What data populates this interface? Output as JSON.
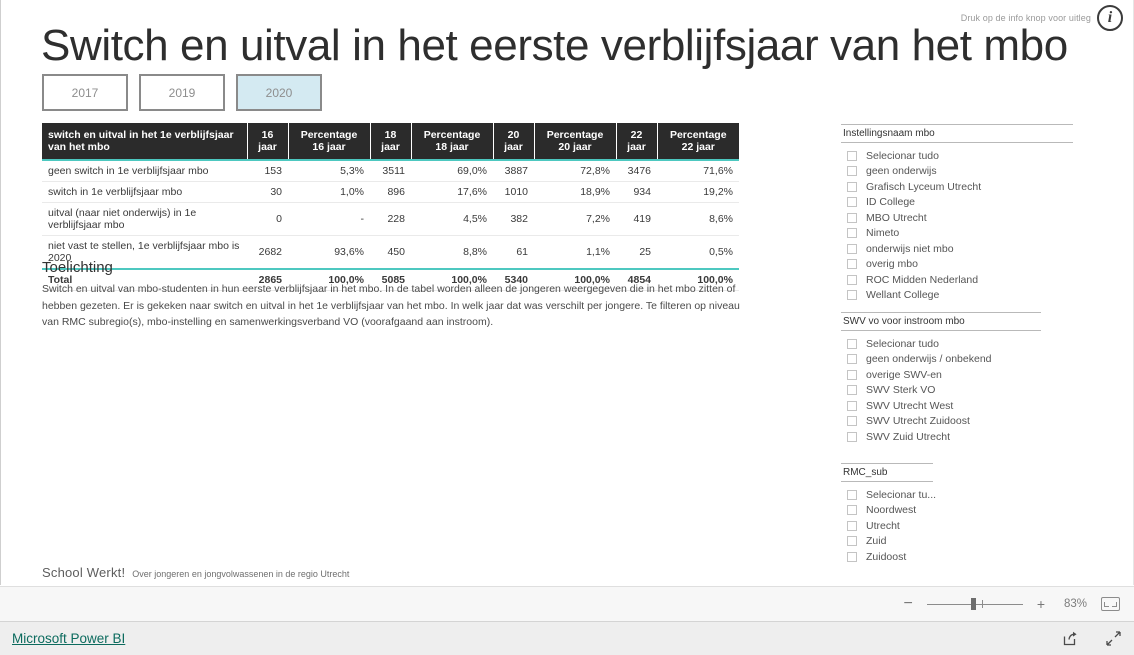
{
  "report": {
    "title": "Switch en uitval in het eerste verblijfsjaar van het mbo",
    "info_hint": "Druk op de info knop voor uitleg",
    "info_icon": "info-circle-icon"
  },
  "year_filter": {
    "options": [
      "2017",
      "2019",
      "2020"
    ],
    "selected": "2020",
    "selected_color": "#d4eaf2"
  },
  "table": {
    "columns": [
      "switch en uitval in het 1e verblijfsjaar van het mbo",
      "16 jaar",
      "Percentage 16 jaar",
      "18 jaar",
      "Percentage 18 jaar",
      "20 jaar",
      "Percentage 20 jaar",
      "22 jaar",
      "Percentage 22 jaar"
    ],
    "rows": [
      [
        "geen switch in 1e verblijfsjaar mbo",
        "153",
        "5,3%",
        "3511",
        "69,0%",
        "3887",
        "72,8%",
        "3476",
        "71,6%"
      ],
      [
        "switch in 1e verblijfsjaar mbo",
        "30",
        "1,0%",
        "896",
        "17,6%",
        "1010",
        "18,9%",
        "934",
        "19,2%"
      ],
      [
        "uitval (naar niet onderwijs) in 1e verblijfsjaar mbo",
        "0",
        "-",
        "228",
        "4,5%",
        "382",
        "7,2%",
        "419",
        "8,6%"
      ],
      [
        "niet vast te stellen, 1e verblijfsjaar mbo is 2020",
        "2682",
        "93,6%",
        "450",
        "8,8%",
        "61",
        "1,1%",
        "25",
        "0,5%"
      ]
    ],
    "total_row": [
      "Total",
      "2865",
      "100,0%",
      "5085",
      "100,0%",
      "5340",
      "100,0%",
      "4854",
      "100,0%"
    ],
    "header_bg": "#2b2b2b",
    "accent_color": "#4dc8c0"
  },
  "toelichting": {
    "heading": "Toelichting",
    "body": "Switch en uitval van mbo-studenten in hun eerste verblijfsjaar in het mbo. In de tabel worden alleen de jongeren weergegeven die in het mbo zitten of hebben gezeten. Er is gekeken naar switch en uitval in het 1e verblijfsjaar van het mbo. In welk jaar dat was verschilt per jongere. Te filteren op niveau van RMC subregio(s), mbo-instelling en samenwerkingsverband VO (voorafgaand aan instroom)."
  },
  "brand": {
    "name": "School Werkt!",
    "tagline": "Over jongeren en jongvolwassenen in de regio Utrecht"
  },
  "slicers": [
    {
      "header": "Instellingsnaam mbo",
      "items": [
        "Selecionar tudo",
        "geen onderwijs",
        "Grafisch Lyceum Utrecht",
        "ID College",
        "MBO Utrecht",
        "Nimeto",
        "onderwijs niet mbo",
        "overig mbo",
        "ROC Midden Nederland",
        "Wellant College"
      ]
    },
    {
      "header": "SWV vo voor instroom mbo",
      "items": [
        "Selecionar tudo",
        "geen onderwijs / onbekend",
        "overige SWV-en",
        "SWV Sterk VO",
        "SWV Utrecht West",
        "SWV Utrecht Zuidoost",
        "SWV Zuid Utrecht"
      ]
    },
    {
      "header": "RMC_sub",
      "items": [
        "Selecionar tu...",
        "Noordwest",
        "Utrecht",
        "Zuid",
        "Zuidoost"
      ]
    }
  ],
  "zoombar": {
    "minus_label": "−",
    "plus_label": "+",
    "zoom_level": "83%",
    "fit_icon": "fit-to-page-icon"
  },
  "footer": {
    "link_label": "Microsoft Power BI",
    "share_icon": "share-icon",
    "fullscreen_icon": "fullscreen-expand-icon"
  }
}
